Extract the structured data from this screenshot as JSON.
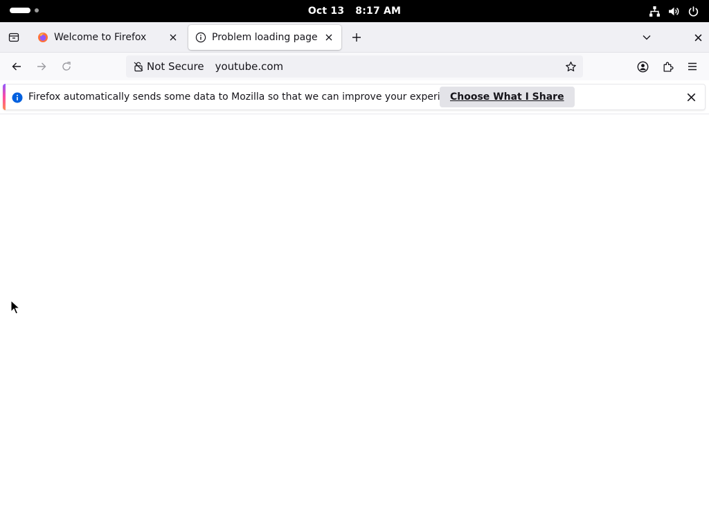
{
  "system_bar": {
    "date": "Oct 13",
    "time": "8:17 AM",
    "tray_icons": [
      "network-icon",
      "volume-icon",
      "power-icon"
    ]
  },
  "tabs": [
    {
      "title": "Welcome to Firefox",
      "favicon": "firefox-icon",
      "active": false
    },
    {
      "title": "Problem loading page",
      "favicon": "info-icon",
      "active": true
    }
  ],
  "navbar": {
    "security_label": "Not Secure",
    "url": "youtube.com"
  },
  "notification": {
    "message": "Firefox automatically sends some data to Mozilla so that we can improve your experience.",
    "button_label": "Choose What I Share",
    "accent_colors": [
      "#9059ff",
      "#ff4aa2",
      "#ff8a50"
    ],
    "info_color": "#0060df"
  }
}
